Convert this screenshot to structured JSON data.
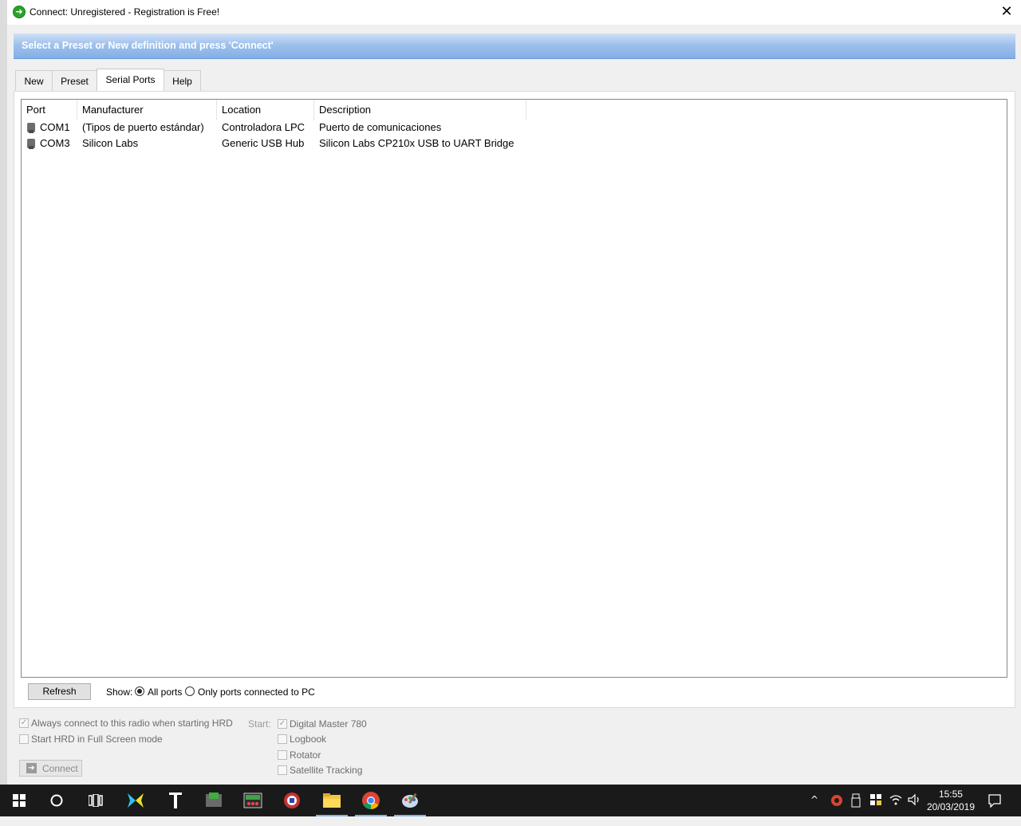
{
  "window": {
    "title": "Connect: Unregistered - Registration is Free!",
    "close_glyph": "✕"
  },
  "banner": {
    "text": "Select a Preset or New definition and press 'Connect'"
  },
  "tabs": [
    {
      "label": "New"
    },
    {
      "label": "Preset"
    },
    {
      "label": "Serial Ports",
      "active": true
    },
    {
      "label": "Help"
    }
  ],
  "ports_table": {
    "columns": [
      "Port",
      "Manufacturer",
      "Location",
      "Description"
    ],
    "rows": [
      {
        "port": "COM1",
        "manufacturer": "(Tipos de puerto estándar)",
        "location": "Controladora LPC",
        "description": "Puerto de comunicaciones"
      },
      {
        "port": "COM3",
        "manufacturer": "Silicon Labs",
        "location": "Generic USB Hub",
        "description": "Silicon Labs CP210x USB to UART Bridge"
      }
    ]
  },
  "controls": {
    "refresh_label": "Refresh",
    "show_label": "Show:",
    "all_ports_label": "All ports",
    "only_connected_label": "Only ports connected to PC",
    "selected_filter": "All ports"
  },
  "options": {
    "always_connect": {
      "label": "Always connect to this radio when starting HRD",
      "checked": true
    },
    "full_screen": {
      "label": "Start HRD in Full Screen mode",
      "checked": false
    },
    "start_label": "Start:",
    "start_items": [
      {
        "label": "Digital Master 780",
        "checked": true
      },
      {
        "label": "Logbook",
        "checked": false
      },
      {
        "label": "Rotator",
        "checked": false
      },
      {
        "label": "Satellite Tracking",
        "checked": false
      }
    ],
    "connect_label": "Connect"
  },
  "taskbar": {
    "time": "15:55",
    "date": "20/03/2019"
  }
}
